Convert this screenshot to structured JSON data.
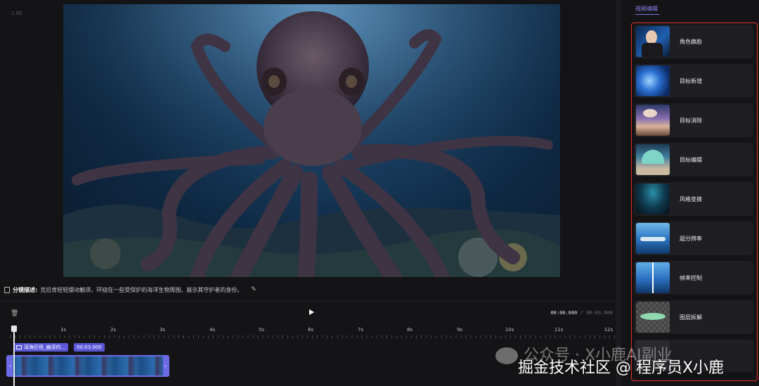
{
  "editor": {
    "zoom": "1.00",
    "description_label": "分镜描述:",
    "description_text": "克拉肯轻轻摆动触须，环绕在一些受保护的海洋生物周围，展示其守护者的身份。",
    "timecode_current": "00:00.000",
    "timecode_separator": " / ",
    "timecode_total": "00:03.000",
    "ruler_labels": [
      "1s",
      "2s",
      "3s",
      "4s",
      "5s",
      "6s",
      "7s",
      "8s",
      "9s",
      "10s",
      "11s",
      "12s"
    ],
    "clip_name": "深海巨怪_幽深的...",
    "clip_duration": "00:03.000"
  },
  "panel": {
    "title": "视频编辑",
    "tools": [
      {
        "label": "角色换脸",
        "thumb": "face-swap"
      },
      {
        "label": "目标新增",
        "thumb": "object-add"
      },
      {
        "label": "目标消除",
        "thumb": "object-remove"
      },
      {
        "label": "目标编辑",
        "thumb": "object-edit"
      },
      {
        "label": "风格变换",
        "thumb": "style-transfer"
      },
      {
        "label": "超分辨率",
        "thumb": "super-resolution"
      },
      {
        "label": "帧率控制",
        "thumb": "frame-rate"
      },
      {
        "label": "图层拆解",
        "thumb": "layer-split"
      }
    ],
    "highlight_color": "#e5312f",
    "accent_color": "#7b75ea"
  },
  "watermark": {
    "line1": "公众号 · X小鹿AI副业",
    "line2": "掘金技术社区 @ 程序员X小鹿"
  }
}
